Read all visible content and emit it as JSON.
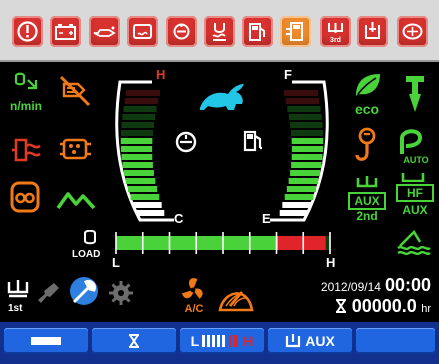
{
  "top_bar": {
    "warnings": [
      {
        "name": "engine-stop-warning-icon",
        "active": false
      },
      {
        "name": "battery-charge-warning-icon",
        "active": false
      },
      {
        "name": "engine-oil-pressure-warning-icon",
        "active": false
      },
      {
        "name": "coolant-level-warning-icon",
        "active": false
      },
      {
        "name": "hydraulic-oil-warning-icon",
        "active": false
      },
      {
        "name": "fuel-filter-warning-icon",
        "active": false
      },
      {
        "name": "fuel-level-warning-icon",
        "active": false
      },
      {
        "name": "fuel-water-separator-warning-icon",
        "active": true
      },
      {
        "name": "auxiliary-3rd-warning-icon",
        "active": false
      },
      {
        "name": "hydraulic-filter-warning-icon",
        "active": false
      },
      {
        "name": "air-filter-warning-icon",
        "active": false
      }
    ]
  },
  "left_indicators": {
    "rpm_label": "n/min",
    "icons": [
      "engine-speed-icon",
      "glow-plug-crossed-icon",
      "engine-preheat-icon",
      "dpf-regeneration-icon",
      "auto-idle-icon",
      "mountain-mode-icon"
    ]
  },
  "center": {
    "speed_mode_icon": "rabbit-high-speed-icon",
    "temp_gauge": {
      "hot_label": "H",
      "cold_label": "C",
      "level_fraction": 0.6,
      "icon": "coolant-temperature-icon"
    },
    "fuel_gauge": {
      "full_label": "F",
      "empty_label": "E",
      "level_fraction": 0.6,
      "icon": "fuel-pump-icon"
    },
    "load_gauge": {
      "label": "LOAD",
      "low_label": "L",
      "high_label": "H",
      "level_fraction": 0.98,
      "icon": "engine-load-icon"
    }
  },
  "right_indicators": {
    "eco_label": "eco",
    "auto_label": "AUTO",
    "aux_2nd": {
      "line1": "AUX",
      "line2": "2nd"
    },
    "hf_aux": {
      "line1": "HF",
      "line2": "AUX"
    },
    "icons": [
      "eco-leaf-icon",
      "attachment-drill-icon",
      "overload-hook-icon",
      "auto-mode-icon",
      "aux-2nd-icon",
      "hf-aux-icon",
      "float-mode-icon"
    ]
  },
  "status_row": {
    "first_label": "1st",
    "ac_label": "A/C",
    "date": "2012/09/14",
    "time": "00:00",
    "hour_meter": "00000.0",
    "hour_unit": "hr",
    "icons": [
      "aux-1st-icon",
      "key-gray-icon",
      "wrench-service-icon",
      "gear-gray-icon",
      "ac-fan-icon",
      "wiper-icon"
    ]
  },
  "tabbar": {
    "tabs": [
      {
        "name": "tab-display",
        "label": ""
      },
      {
        "name": "tab-hourglass",
        "label": ""
      },
      {
        "name": "tab-level",
        "label_left": "L",
        "label_right": "H"
      },
      {
        "name": "tab-aux",
        "label": "AUX"
      },
      {
        "name": "tab-blank",
        "label": ""
      }
    ]
  },
  "colors": {
    "warning_red": "#d8322f",
    "warning_active_orange": "#ee8a2c",
    "indicator_green": "#49d23a",
    "indicator_red": "#e03a24",
    "indicator_orange": "#ef7a17",
    "rabbit_cyan": "#22c7e7",
    "tab_blue": "#1f66e0"
  }
}
